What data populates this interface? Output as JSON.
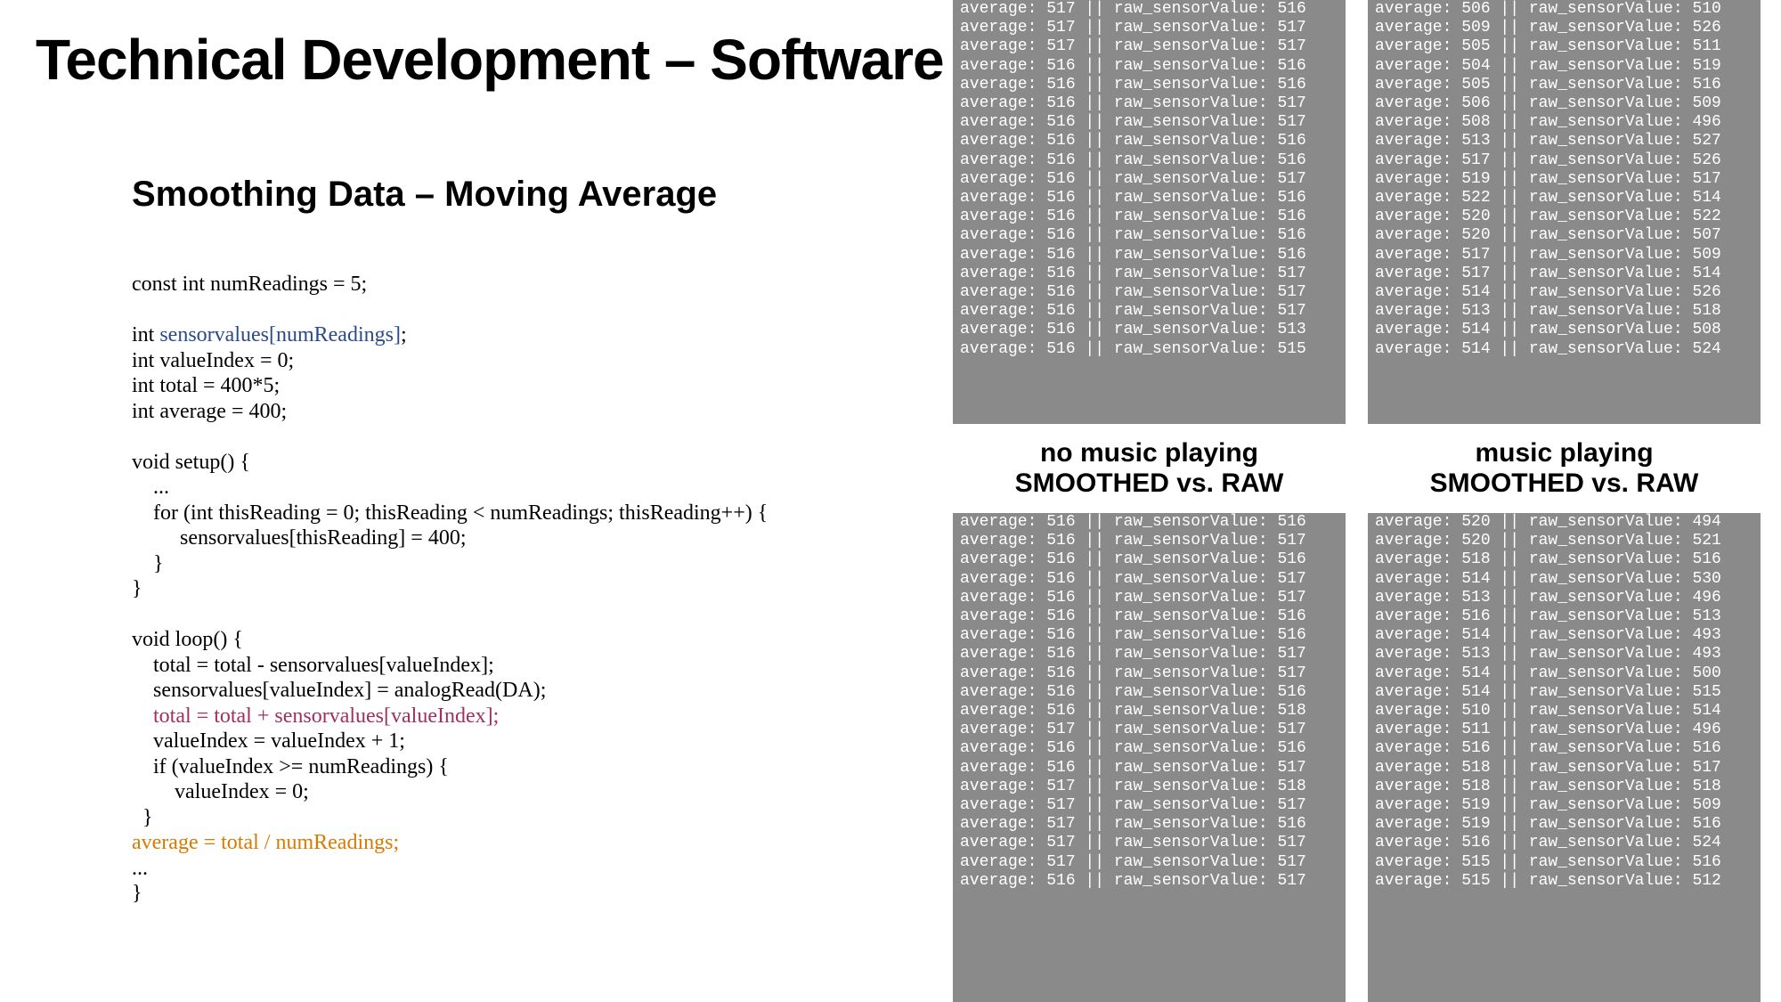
{
  "title": "Technical Development – Software",
  "subtitle": "Smoothing Data – Moving Average",
  "code": {
    "l01": "const int numReadings = 5;",
    "l02": "",
    "l03a": "int ",
    "l03b": "sensorvalues[numReadings]",
    "l03c": ";",
    "l04": "int valueIndex = 0;",
    "l05": "int total = 400*5;",
    "l06": "int average = 400;",
    "l07": "",
    "l08": "void setup() {",
    "l09": "    ...",
    "l10": "    for (int thisReading = 0; thisReading < numReadings; thisReading++) {",
    "l11": "         sensorvalues[thisReading] = 400;",
    "l12": "    }",
    "l13": "}",
    "l14": "",
    "l15": "void loop() {",
    "l16": "    total = total - sensorvalues[valueIndex];",
    "l17": "    sensorvalues[valueIndex] = analogRead(DA);",
    "l18a": "    ",
    "l18b": "total = total + sensorvalues[valueIndex];",
    "l19": "    valueIndex = valueIndex + 1;",
    "l20": "    if (valueIndex >= numReadings) {",
    "l21": "        valueIndex = 0;",
    "l22": "  }",
    "l23": "average = total / numReadings;",
    "l24": "...",
    "l25": "}"
  },
  "labels": {
    "left1": "no music playing",
    "left2": "SMOOTHED vs. RAW",
    "right1": "music playing",
    "right2": "SMOOTHED vs. RAW"
  },
  "serial_left_top": [
    {
      "avg": 517,
      "raw": 516
    },
    {
      "avg": 517,
      "raw": 517
    },
    {
      "avg": 517,
      "raw": 517
    },
    {
      "avg": 516,
      "raw": 516
    },
    {
      "avg": 516,
      "raw": 516
    },
    {
      "avg": 516,
      "raw": 517
    },
    {
      "avg": 516,
      "raw": 517
    },
    {
      "avg": 516,
      "raw": 516
    },
    {
      "avg": 516,
      "raw": 516
    },
    {
      "avg": 516,
      "raw": 517
    },
    {
      "avg": 516,
      "raw": 516
    },
    {
      "avg": 516,
      "raw": 516
    },
    {
      "avg": 516,
      "raw": 516
    },
    {
      "avg": 516,
      "raw": 516
    },
    {
      "avg": 516,
      "raw": 517
    },
    {
      "avg": 516,
      "raw": 517
    },
    {
      "avg": 516,
      "raw": 517
    },
    {
      "avg": 516,
      "raw": 513
    },
    {
      "avg": 516,
      "raw": 515
    }
  ],
  "serial_left_bot": [
    {
      "avg": 516,
      "raw": 516
    },
    {
      "avg": 516,
      "raw": 517
    },
    {
      "avg": 516,
      "raw": 516
    },
    {
      "avg": 516,
      "raw": 517
    },
    {
      "avg": 516,
      "raw": 517
    },
    {
      "avg": 516,
      "raw": 516
    },
    {
      "avg": 516,
      "raw": 516
    },
    {
      "avg": 516,
      "raw": 517
    },
    {
      "avg": 516,
      "raw": 517
    },
    {
      "avg": 516,
      "raw": 516
    },
    {
      "avg": 516,
      "raw": 518
    },
    {
      "avg": 517,
      "raw": 517
    },
    {
      "avg": 516,
      "raw": 516
    },
    {
      "avg": 516,
      "raw": 517
    },
    {
      "avg": 517,
      "raw": 518
    },
    {
      "avg": 517,
      "raw": 517
    },
    {
      "avg": 517,
      "raw": 516
    },
    {
      "avg": 517,
      "raw": 517
    },
    {
      "avg": 517,
      "raw": 517
    },
    {
      "avg": 516,
      "raw": 517
    }
  ],
  "serial_right_top": [
    {
      "avg": 506,
      "raw": 510
    },
    {
      "avg": 509,
      "raw": 526
    },
    {
      "avg": 505,
      "raw": 511
    },
    {
      "avg": 504,
      "raw": 519
    },
    {
      "avg": 505,
      "raw": 516
    },
    {
      "avg": 506,
      "raw": 509
    },
    {
      "avg": 508,
      "raw": 496
    },
    {
      "avg": 513,
      "raw": 527
    },
    {
      "avg": 517,
      "raw": 526
    },
    {
      "avg": 519,
      "raw": 517
    },
    {
      "avg": 522,
      "raw": 514
    },
    {
      "avg": 520,
      "raw": 522
    },
    {
      "avg": 520,
      "raw": 507
    },
    {
      "avg": 517,
      "raw": 509
    },
    {
      "avg": 517,
      "raw": 514
    },
    {
      "avg": 514,
      "raw": 526
    },
    {
      "avg": 513,
      "raw": 518
    },
    {
      "avg": 514,
      "raw": 508
    },
    {
      "avg": 514,
      "raw": 524
    }
  ],
  "serial_right_bot": [
    {
      "avg": 520,
      "raw": 494
    },
    {
      "avg": 520,
      "raw": 521
    },
    {
      "avg": 518,
      "raw": 516
    },
    {
      "avg": 514,
      "raw": 530
    },
    {
      "avg": 513,
      "raw": 496
    },
    {
      "avg": 516,
      "raw": 513
    },
    {
      "avg": 514,
      "raw": 493
    },
    {
      "avg": 513,
      "raw": 493
    },
    {
      "avg": 514,
      "raw": 500
    },
    {
      "avg": 514,
      "raw": 515
    },
    {
      "avg": 510,
      "raw": 514
    },
    {
      "avg": 511,
      "raw": 496
    },
    {
      "avg": 516,
      "raw": 516
    },
    {
      "avg": 518,
      "raw": 517
    },
    {
      "avg": 518,
      "raw": 518
    },
    {
      "avg": 519,
      "raw": 509
    },
    {
      "avg": 519,
      "raw": 516
    },
    {
      "avg": 516,
      "raw": 524
    },
    {
      "avg": 515,
      "raw": 516
    },
    {
      "avg": 515,
      "raw": 512
    }
  ]
}
